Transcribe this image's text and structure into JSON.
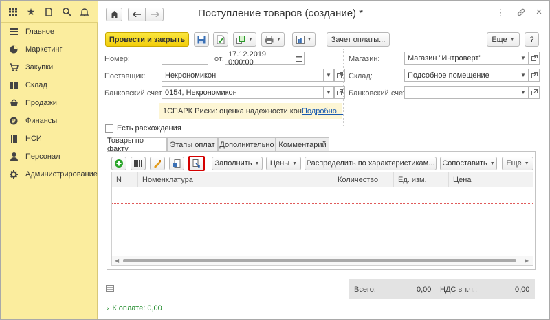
{
  "sidebar": {
    "items": [
      {
        "label": "Главное",
        "icon": "menu-lines-icon"
      },
      {
        "label": "Маркетинг",
        "icon": "pie-chart-icon"
      },
      {
        "label": "Закупки",
        "icon": "cart-icon"
      },
      {
        "label": "Склад",
        "icon": "grid-icon"
      },
      {
        "label": "Продажи",
        "icon": "basket-icon"
      },
      {
        "label": "Финансы",
        "icon": "coin-icon"
      },
      {
        "label": "НСИ",
        "icon": "book-icon"
      },
      {
        "label": "Персонал",
        "icon": "person-icon"
      },
      {
        "label": "Администрирование",
        "icon": "gear-icon"
      }
    ]
  },
  "header": {
    "title": "Поступление товаров (создание) *"
  },
  "toolbar": {
    "post_close_label": "Провести и закрыть",
    "payment_offset_label": "Зачет оплаты...",
    "more_label": "Еще",
    "help_label": "?"
  },
  "form": {
    "number_label": "Номер:",
    "number_value": "",
    "date_label": "от:",
    "date_value": "17.12.2019  0:00:00",
    "shop_label": "Магазин:",
    "shop_value": "Магазин \"Интроверт\"",
    "supplier_label": "Поставщик:",
    "supplier_value": "Некрономикон",
    "warehouse_label": "Склад:",
    "warehouse_value": "Подсобное помещение",
    "bank_label": "Банковский счет:",
    "bank_value": "0154, Некрономикон",
    "bank2_label": "Банковский счет:",
    "bank2_value": "",
    "spark_text": "1СПАРК Риски: оценка надежности кон...",
    "spark_link": "Подробно...",
    "discrepancy_label": "Есть расхождения"
  },
  "tabs": [
    {
      "label": "Товары по факту"
    },
    {
      "label": "Этапы оплат"
    },
    {
      "label": "Дополнительно"
    },
    {
      "label": "Комментарий"
    }
  ],
  "table_toolbar": {
    "fill_label": "Заполнить",
    "prices_label": "Цены",
    "distribute_label": "Распределить по характеристикам...",
    "compare_label": "Сопоставить",
    "more_label": "Еще"
  },
  "table": {
    "columns": [
      "N",
      "Номенклатура",
      "Количество",
      "Ед. изм.",
      "Цена"
    ]
  },
  "totals": {
    "total_label": "Всего:",
    "total_value": "0,00",
    "vat_label": "НДС в т.ч.:",
    "vat_value": "0,00"
  },
  "payment": {
    "label": "К оплате: 0,00"
  },
  "colors": {
    "sidebar_bg": "#fbed9e",
    "primary_button": "#f5d81c",
    "highlight_border": "#d40000",
    "link": "#1a5bb0",
    "payment_text": "#1f8a2a"
  }
}
